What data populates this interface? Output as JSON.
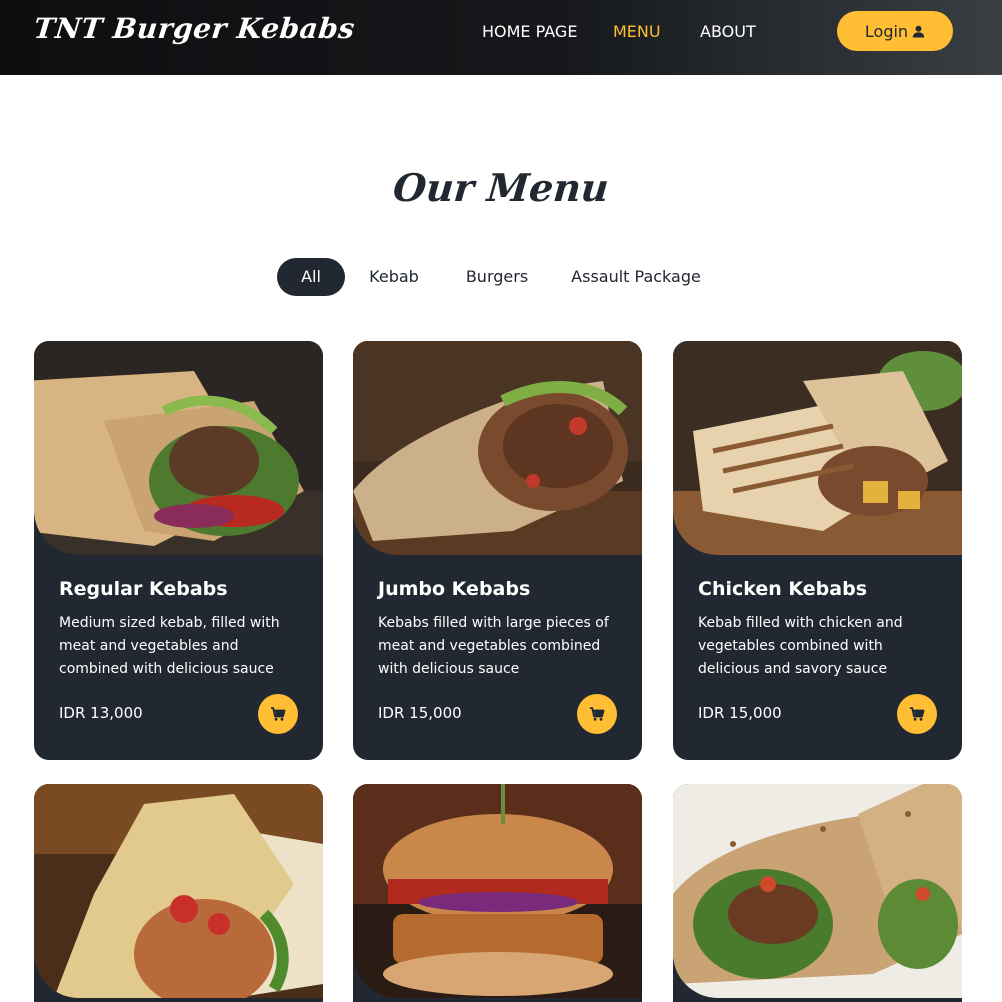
{
  "header": {
    "brand": "TNT Burger Kebabs",
    "nav": [
      {
        "label": "HOME PAGE",
        "active": false
      },
      {
        "label": "MENU",
        "active": true
      },
      {
        "label": "ABOUT",
        "active": false
      }
    ],
    "login_label": "Login",
    "login_icon": "user-icon"
  },
  "section": {
    "title": "Our Menu"
  },
  "filters": [
    {
      "label": "All",
      "active": true
    },
    {
      "label": "Kebab",
      "active": false
    },
    {
      "label": "Burgers",
      "active": false
    },
    {
      "label": "Assault Package",
      "active": false
    }
  ],
  "menu_items": [
    {
      "name": "Regular Kebabs",
      "description": "Medium sized kebab, filled with meat and vegetables and combined with delicious sauce",
      "price": "IDR 13,000",
      "image": "regular-kebab-photo"
    },
    {
      "name": "Jumbo Kebabs",
      "description": "Kebabs filled with large pieces of meat and vegetables combined with delicious sauce",
      "price": "IDR 15,000",
      "image": "jumbo-kebab-photo"
    },
    {
      "name": "Chicken Kebabs",
      "description": "Kebab filled with chicken and vegetables combined with delicious and savory sauce",
      "price": "IDR 15,000",
      "image": "chicken-kebab-photo"
    },
    {
      "image": "wrap-photo"
    },
    {
      "image": "burger-photo"
    },
    {
      "image": "grilled-wrap-photo"
    }
  ],
  "colors": {
    "accent": "#ffbe33",
    "dark": "#222831",
    "header_bg": "#0d0e10"
  }
}
